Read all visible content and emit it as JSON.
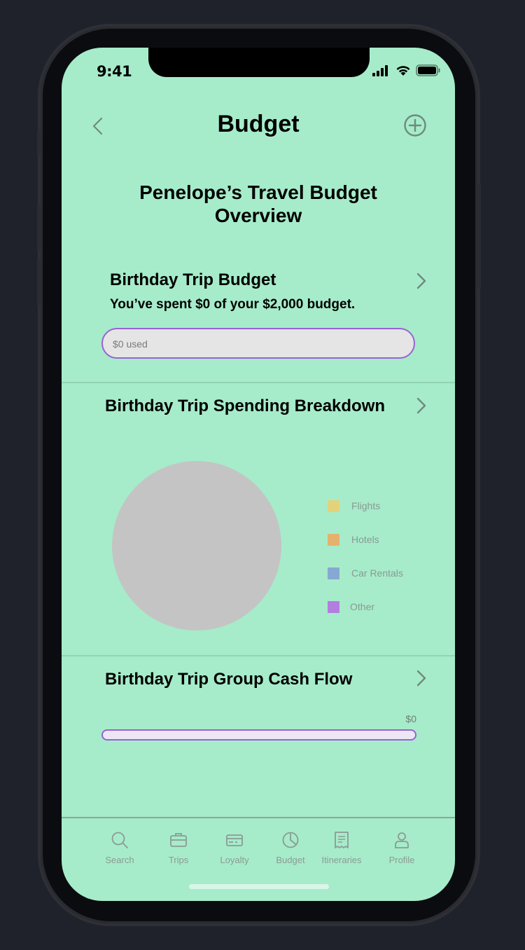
{
  "status_bar": {
    "time": "9:41"
  },
  "header": {
    "title": "Budget"
  },
  "overview": {
    "title": "Penelope’s Travel Budget Overview"
  },
  "budget_section": {
    "title": "Birthday Trip Budget",
    "subtitle": "You’ve spent $0 of your $2,000 budget.",
    "bar_label": "$0 used",
    "used_fraction": 0
  },
  "breakdown_section": {
    "title": "Birthday Trip Spending Breakdown",
    "legend": [
      {
        "label": "Flights",
        "color": "#e3d27a"
      },
      {
        "label": "Hotels",
        "color": "#e5b26e"
      },
      {
        "label": "Car Rentals",
        "color": "#88a8d4"
      },
      {
        "label": "Other",
        "color": "#b27ee0"
      }
    ],
    "pie_color": "#c4c4c4"
  },
  "cashflow_section": {
    "title": "Birthday Trip Group Cash Flow",
    "amount": "$0"
  },
  "tabs": [
    {
      "label": "Search",
      "icon": "search-icon"
    },
    {
      "label": "Trips",
      "icon": "briefcase-icon"
    },
    {
      "label": "Loyalty",
      "icon": "card-icon"
    },
    {
      "label": "Budget",
      "icon": "pie-chart-icon"
    },
    {
      "label": "Itineraries",
      "icon": "receipt-icon"
    },
    {
      "label": "Profile",
      "icon": "person-icon"
    }
  ],
  "colors": {
    "screen_background": "#a6ecca",
    "accent": "#9a62d6",
    "device_background": "#20222b"
  }
}
